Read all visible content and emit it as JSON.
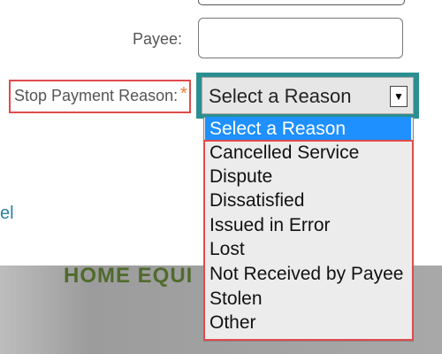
{
  "form": {
    "payee_label": "Payee:",
    "payee_value": "",
    "reason_label": "Stop Payment Reason:",
    "required_mark": "*",
    "reason_selected": "Select a Reason",
    "reason_arrow_icon": "dropdown-triangle",
    "cancel_link_fragment": "el"
  },
  "dropdown": {
    "options": [
      "Select a Reason",
      "Cancelled Service",
      "Dispute",
      "Dissatisfied",
      "Issued in Error",
      "Lost",
      "Not Received by Payee",
      "Stolen",
      "Other"
    ],
    "highlighted_index": 0
  },
  "banner": {
    "text_fragment": "HOME EQUI"
  },
  "colors": {
    "focus_border": "#2c8f8f",
    "annotation_red": "#e04b4b",
    "required": "#f07a2a",
    "highlight": "#1e90ff",
    "link": "#2c7fa3"
  }
}
